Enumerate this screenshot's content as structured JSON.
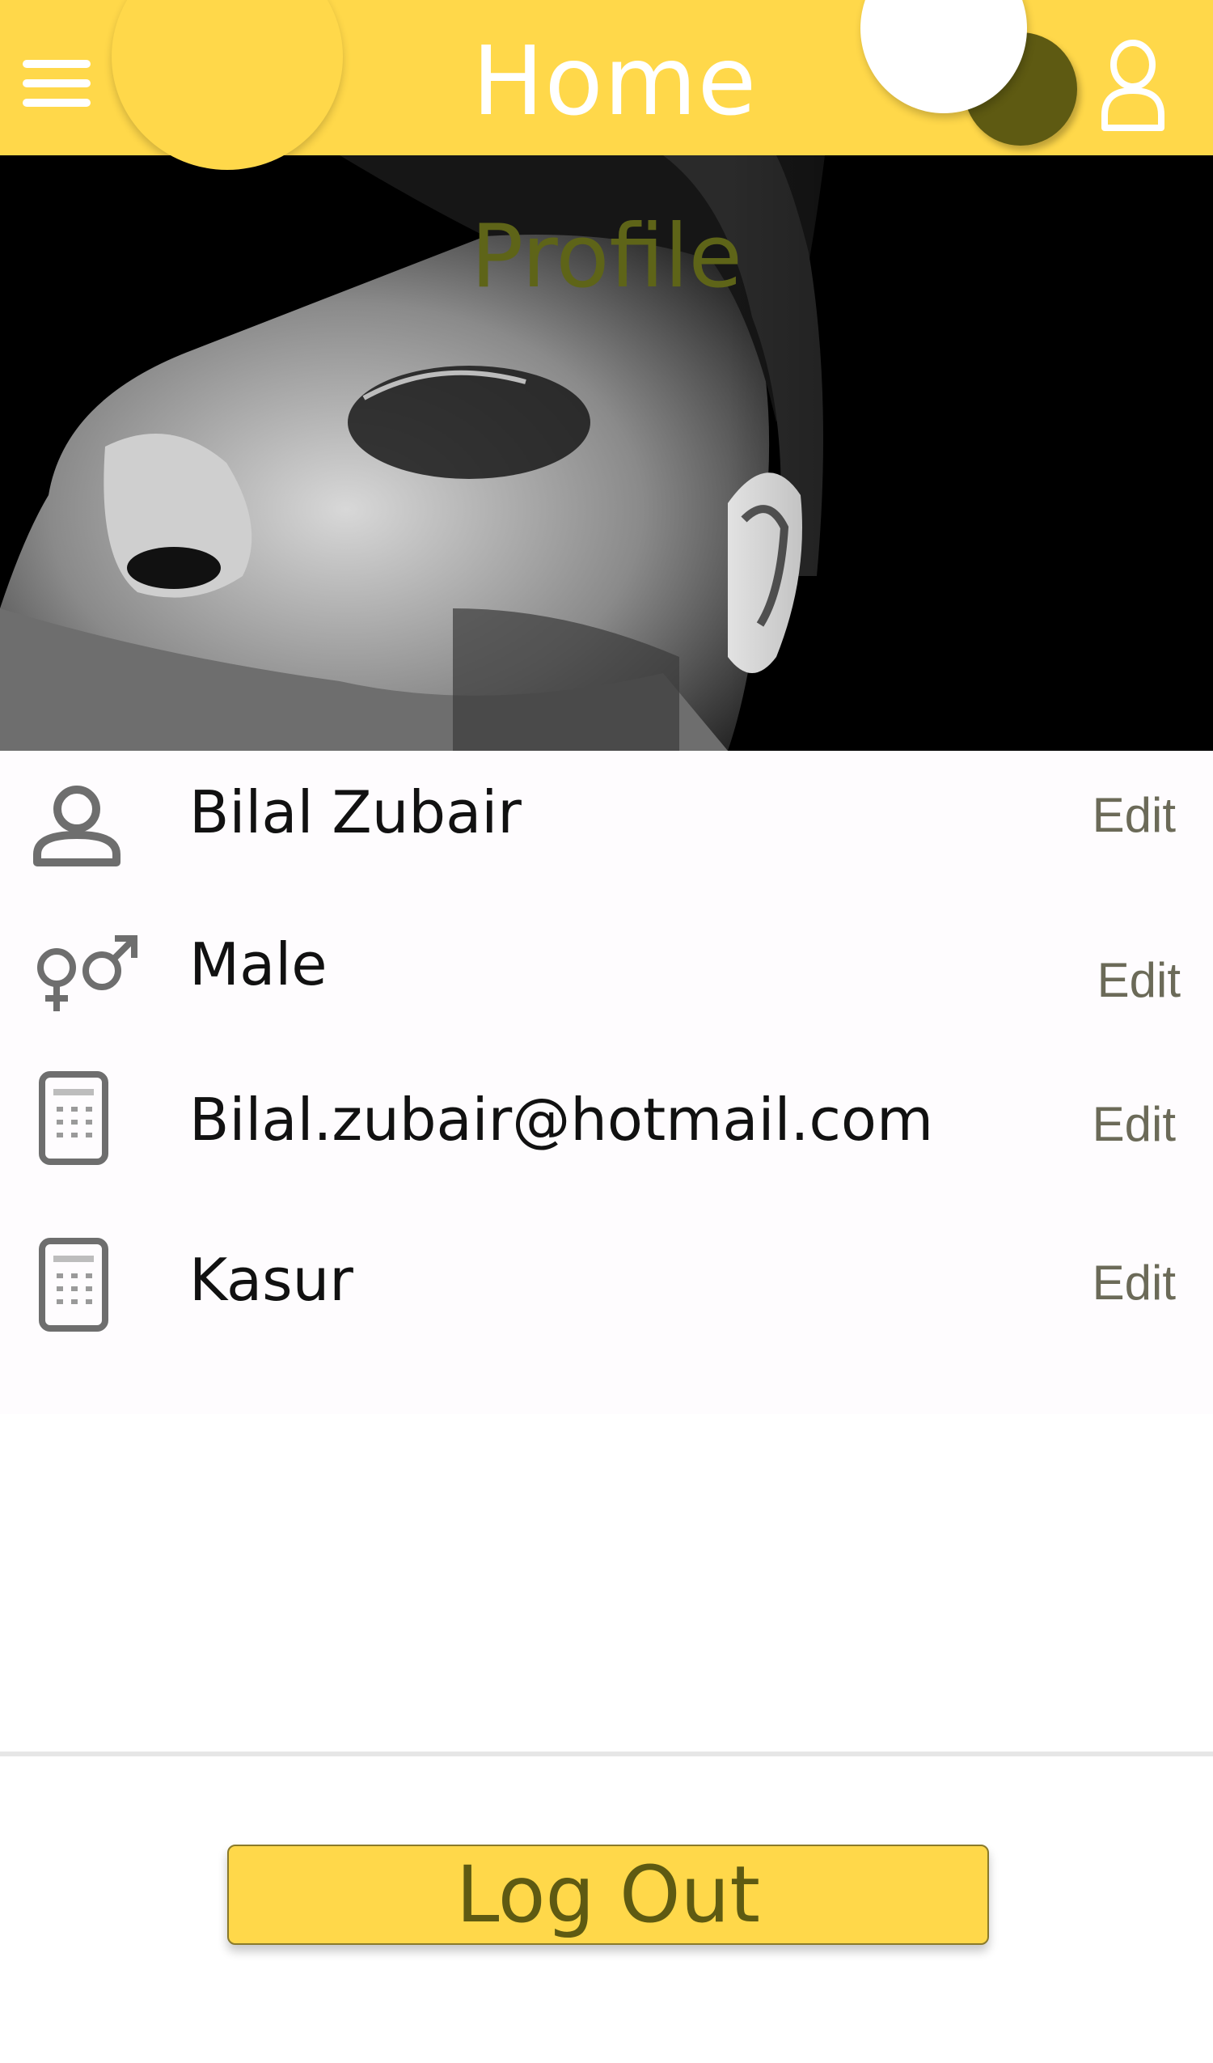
{
  "header": {
    "title": "Home",
    "menu_icon": "hamburger-menu-icon",
    "account_icon": "person-outline-icon"
  },
  "cover": {
    "title": "Profile",
    "image": "grayscale close-up portrait photo of a man's face"
  },
  "profile": {
    "rows": [
      {
        "icon": "person-icon",
        "value": "Bilal Zubair",
        "edit_label": "Edit"
      },
      {
        "icon": "gender-icon",
        "value": "Male",
        "edit_label": "Edit"
      },
      {
        "icon": "phone-icon",
        "value": "Bilal.zubair@hotmail.com",
        "edit_label": "Edit"
      },
      {
        "icon": "phone-icon",
        "value": "Kasur",
        "edit_label": "Edit"
      }
    ]
  },
  "footer": {
    "logout_label": "Log Out"
  },
  "colors": {
    "primary": "#FFD84A",
    "accent_dark": "#5E5A12",
    "cover_title": "#5E6418",
    "edit_text": "#6B6A58",
    "icon_gray": "#6E6E6E"
  }
}
